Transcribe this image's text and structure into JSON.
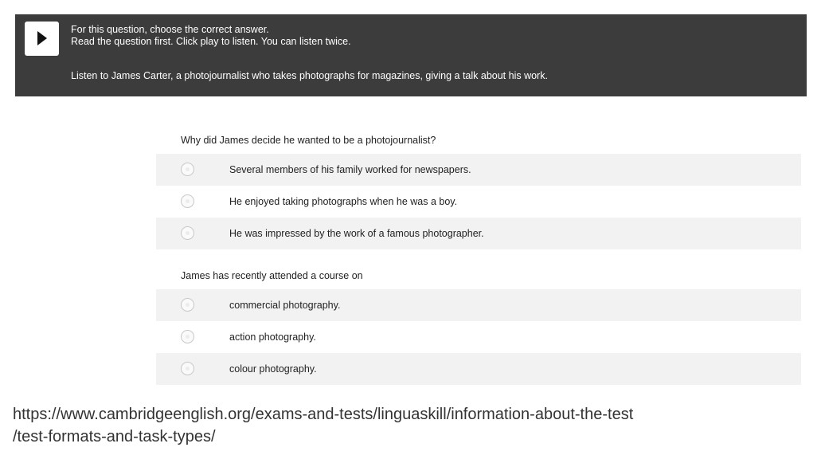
{
  "instructions": {
    "line1": "For this question, choose the correct answer.",
    "line2": "Read the question first. Click play to listen. You can listen twice.",
    "context": "Listen to James Carter, a photojournalist who takes photographs for magazines, giving a talk about his work.",
    "play_icon": "play-icon"
  },
  "questions": [
    {
      "text": "Why did James decide he wanted to be a photojournalist?",
      "options": [
        "Several members of his family worked for newspapers.",
        "He enjoyed taking photographs when he was a boy.",
        "He was impressed by the work of a famous photographer."
      ]
    },
    {
      "text": "James has recently attended a course on",
      "options": [
        "commercial photography.",
        "action photography.",
        "colour photography."
      ]
    }
  ],
  "source_url": {
    "line1": "https://www.cambridgeenglish.org/exams-and-tests/linguaskill/information-about-the-test",
    "line2": "/test-formats-and-task-types/"
  },
  "colors": {
    "instruction_bar": "#3c3c3c",
    "option_shade": "#f2f2f2"
  }
}
